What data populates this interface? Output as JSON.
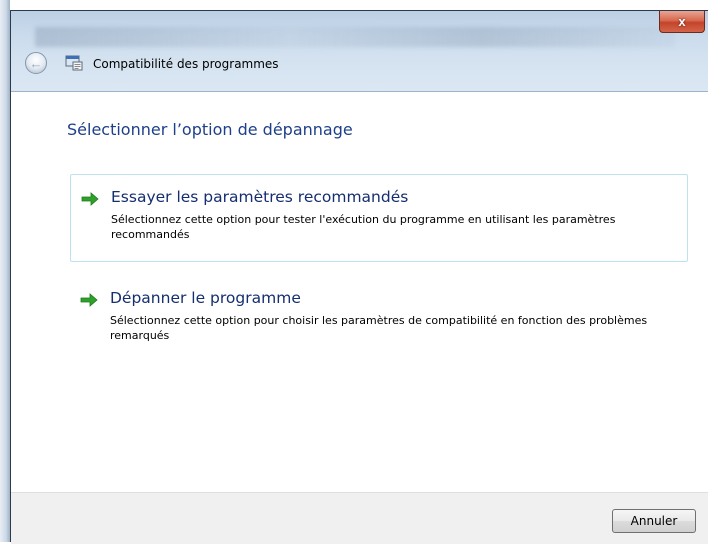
{
  "window": {
    "title": "Compatibilité des programmes",
    "close_glyph": "x",
    "back_icon": "back-arrow-icon",
    "app_icon": "program-compatibility-icon"
  },
  "main": {
    "heading": "Sélectionner l’option de dépannage",
    "options": [
      {
        "title": "Essayer les paramètres recommandés",
        "description": "Sélectionnez cette option pour tester l'exécution du programme en utilisant les paramètres recommandés",
        "icon": "green-arrow-icon"
      },
      {
        "title": "Dépanner le programme",
        "description": "Sélectionnez cette option pour choisir les paramètres de compatibilité en fonction des problèmes remarqués",
        "icon": "green-arrow-icon"
      }
    ]
  },
  "footer": {
    "cancel_label": "Annuler"
  },
  "colors": {
    "heading": "#1e3f8a",
    "option_title": "#152e70",
    "arrow_green": "#2fa12b",
    "highlight_border": "#bfe3ee"
  }
}
